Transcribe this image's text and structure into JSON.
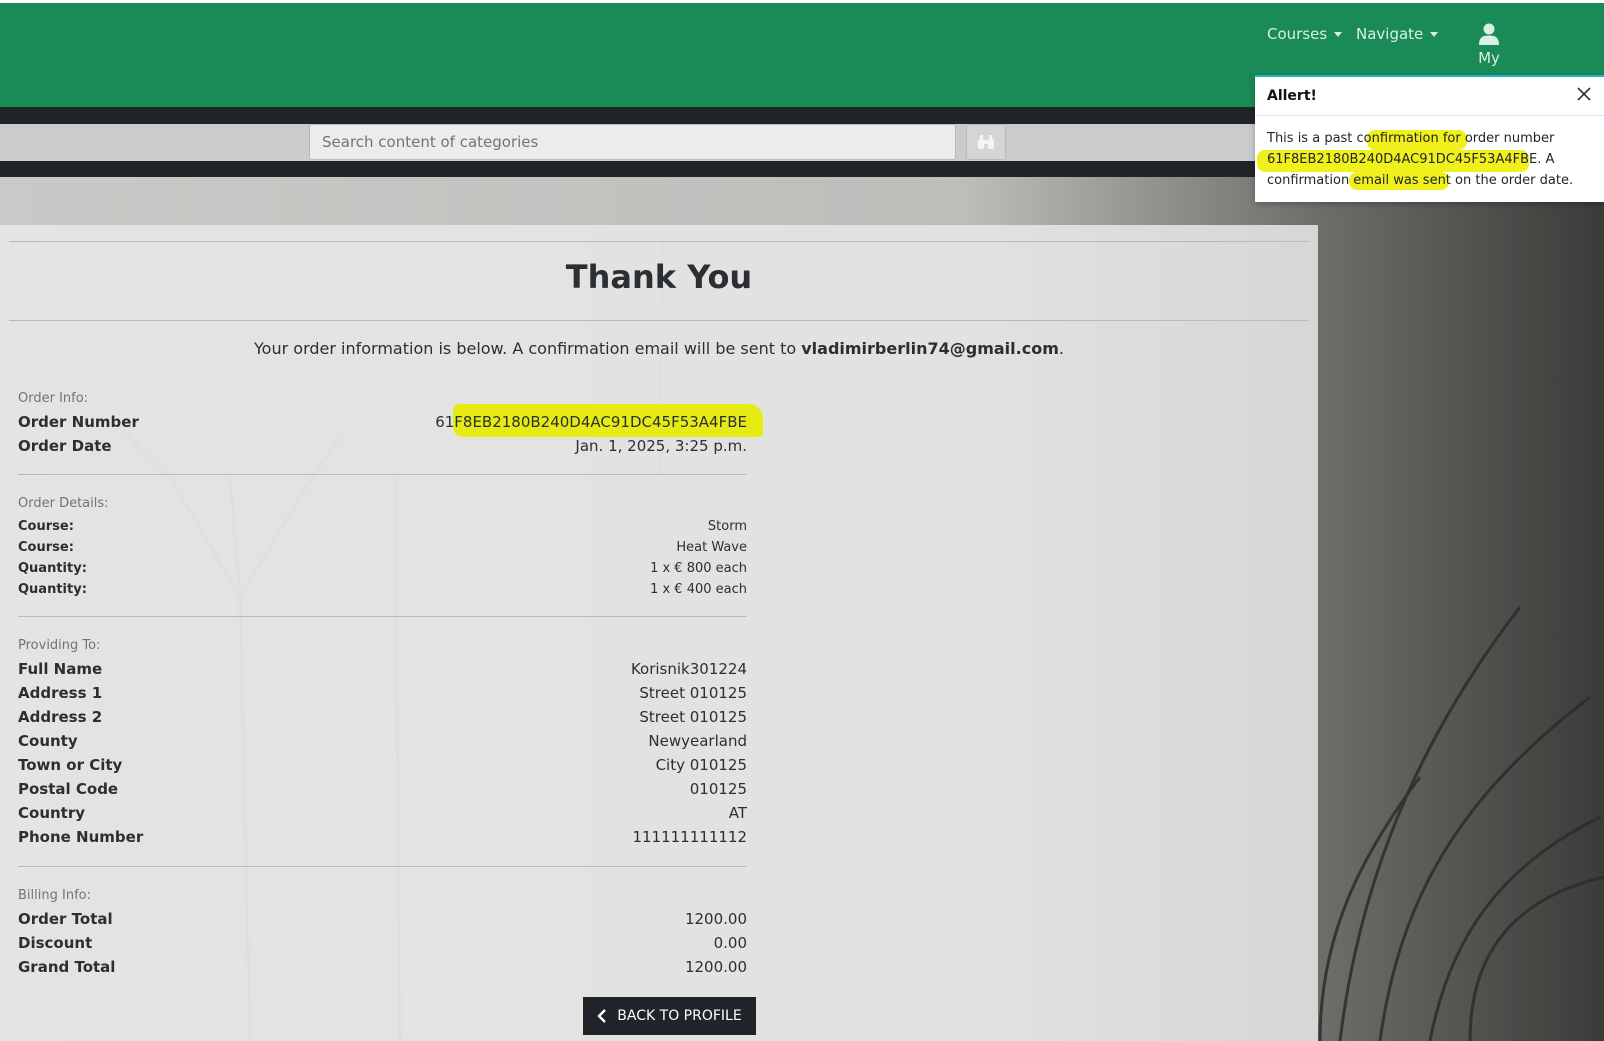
{
  "nav": {
    "courses": "Courses",
    "navigate": "Navigate",
    "account": "My"
  },
  "search": {
    "placeholder": "Search content of categories"
  },
  "alert": {
    "title": "Allert!",
    "line1": "This is a past confirmation for order number",
    "line2": "61F8EB2180B240D4AC91DC45F53A4FBE. A",
    "line3": "confirmation email was sent on the order date."
  },
  "page": {
    "title": "Thank You",
    "lead_text": "Your order information is below. A confirmation email will be sent to ",
    "email": "vladimirberlin74@gmail.com",
    "lead_end": "."
  },
  "order_info": {
    "label": "Order Info:",
    "rows": [
      {
        "key": "Order Number",
        "value": "61F8EB2180B240D4AC91DC45F53A4FBE"
      },
      {
        "key": "Order Date",
        "value": "Jan. 1, 2025, 3:25 p.m."
      }
    ]
  },
  "order_details": {
    "label": "Order Details:",
    "rows": [
      {
        "key": "Course:",
        "value": "Storm"
      },
      {
        "key": "Course:",
        "value": "Heat Wave"
      },
      {
        "key": "Quantity:",
        "value": "1 x  € 800 each"
      },
      {
        "key": "Quantity:",
        "value": "1 x  € 400 each"
      }
    ]
  },
  "providing_to": {
    "label": "Providing To:",
    "rows": [
      {
        "key": "Full Name",
        "value": "Korisnik301224"
      },
      {
        "key": "Address 1",
        "value": "Street 010125"
      },
      {
        "key": "Address 2",
        "value": "Street 010125"
      },
      {
        "key": "County",
        "value": "Newyearland"
      },
      {
        "key": "Town or City",
        "value": "City 010125"
      },
      {
        "key": "Postal Code",
        "value": "010125"
      },
      {
        "key": "Country",
        "value": "AT"
      },
      {
        "key": "Phone Number",
        "value": "111111111112"
      }
    ]
  },
  "billing": {
    "label": "Billing Info:",
    "rows": [
      {
        "key": "Order Total",
        "value": "1200.00"
      },
      {
        "key": "Discount",
        "value": "0.00"
      },
      {
        "key": "Grand Total",
        "value": "1200.00"
      }
    ]
  },
  "back_button": "BACK TO PROFILE",
  "colors": {
    "header": "#1a8a57",
    "dark": "#212529",
    "highlight": "#e6ec13"
  }
}
